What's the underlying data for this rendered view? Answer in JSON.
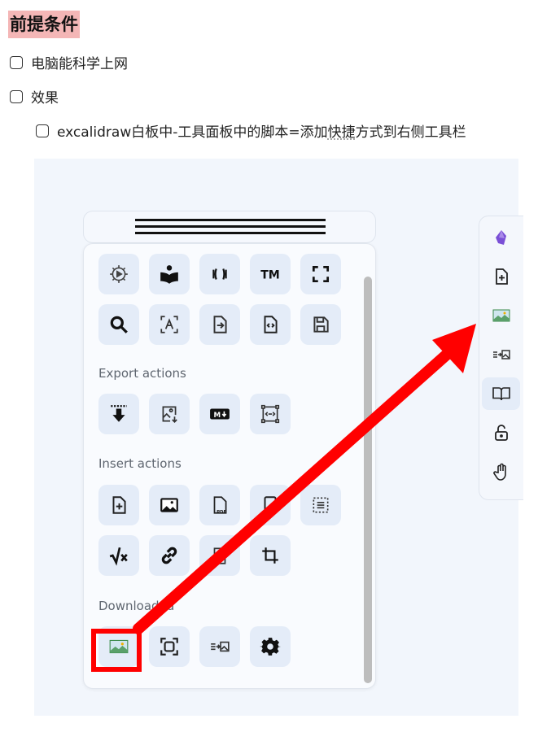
{
  "heading": "前提条件",
  "checklist": [
    {
      "label": "电脑能科学上网"
    },
    {
      "label": "效果"
    },
    {
      "label_main": "excalidraw白板中-工具面板中的脚本=添加",
      "label_dotted": "快捷",
      "label_end": "方式到右侧工具栏"
    }
  ],
  "screenshot": {
    "sections": {
      "export": "Export actions",
      "insert": "Insert actions",
      "downloaded": "Downloaded"
    },
    "icons": {
      "row1": [
        "settings-play-icon",
        "reading-person-icon",
        "brackets-icon",
        "tm-icon",
        "fullscreen-icon"
      ],
      "row2": [
        "search-icon",
        "text-scan-icon",
        "file-import-icon",
        "file-code-icon",
        "save-icon"
      ],
      "export": [
        "download-to-line-icon",
        "image-download-icon",
        "markdown-icon",
        "embed-frame-icon"
      ],
      "insert_row1": [
        "file-add-icon",
        "image-icon",
        "pdf-icon",
        "document-icon",
        "list-box-icon"
      ],
      "insert_row2": [
        "sqrt-x-icon",
        "link-icon",
        "page-icon",
        "crop-icon"
      ],
      "downloaded": [
        "image-landscape-icon",
        "frame-select-icon",
        "list-image-icon",
        "gear-icon"
      ]
    },
    "right_toolbar": [
      "obsidian-crystal-icon",
      "file-add-icon",
      "image-landscape-icon",
      "list-image-icon",
      "book-open-icon",
      "lock-open-icon",
      "hand-icon"
    ],
    "colors": {
      "annotation": "#ff0000",
      "heading_highlight": "#f4b6b6",
      "button_bg": "#e4ecf8"
    }
  }
}
